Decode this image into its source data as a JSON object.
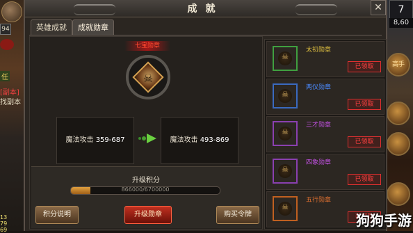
{
  "window": {
    "title": "成就"
  },
  "tabs": [
    {
      "label": "英雄成就",
      "active": false
    },
    {
      "label": "成就勋章",
      "active": true
    }
  ],
  "medal": {
    "title": "七宝勋章"
  },
  "stats": {
    "current_label": "魔法攻击",
    "current_value": "359-687",
    "next_label": "魔法攻击",
    "next_value": "493-869"
  },
  "upgrade": {
    "label": "升级积分",
    "progress_text": "866000/6700000",
    "progress_fraction": 0.1293
  },
  "buttons": {
    "explain": "积分说明",
    "upgrade": "升级勋章",
    "buy": "购买令牌"
  },
  "medal_list": [
    {
      "name": "太初勋章",
      "status": "已领取",
      "name_color": "#e0c040",
      "frame_color": "#40a040"
    },
    {
      "name": "两仪勋章",
      "status": "已领取",
      "name_color": "#4a8aff",
      "frame_color": "#3a6ac0"
    },
    {
      "name": "三才勋章",
      "status": "已领取",
      "name_color": "#c050e0",
      "frame_color": "#8a40b0"
    },
    {
      "name": "四象勋章",
      "status": "已领取",
      "name_color": "#c050e0",
      "frame_color": "#8a40b0"
    },
    {
      "name": "五行勋章",
      "status": "已领取",
      "name_color": "#e07030",
      "frame_color": "#c06020"
    }
  ],
  "hud_left": {
    "level": "94",
    "task_label": "任",
    "copy_label": "[副本]",
    "find_label": "找副本",
    "nums": [
      "13",
      "79",
      "69"
    ]
  },
  "hud_right": {
    "level": "7",
    "coord": "8,60",
    "icon_label": "高手"
  },
  "watermark": "狗狗手游"
}
